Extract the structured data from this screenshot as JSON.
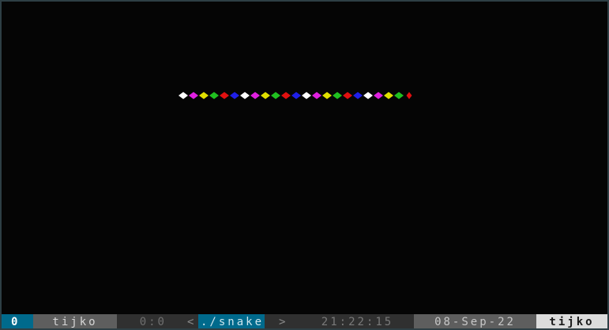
{
  "terminal": {
    "snake": {
      "segment_colors": [
        "#ffffff",
        "#e020e0",
        "#e0e000",
        "#20c020",
        "#e01010",
        "#1f1fe8",
        "#ffffff",
        "#e020e0",
        "#e0e000",
        "#20c020",
        "#e01010",
        "#1f1fe8",
        "#ffffff",
        "#e020e0",
        "#e0e000",
        "#20c020",
        "#e01010",
        "#1f1fe8",
        "#ffffff",
        "#e020e0",
        "#e0e000",
        "#20c020",
        "#e01010"
      ]
    }
  },
  "statusbar": {
    "window_index": "0",
    "session_name": "tijko",
    "pane_position": "0:0",
    "path_left_marker": "<",
    "path": "./snake",
    "path_right_marker": ">",
    "time": "21:22:15",
    "date": "08-Sep-22",
    "hostname": "tijko"
  },
  "colors": {
    "terminal_bg": "#050505",
    "accent": "#006a8c",
    "statusbar_mid": "#303030",
    "statusbar_light": "#5e5e5e",
    "statusbar_host": "#dcdcdc"
  }
}
